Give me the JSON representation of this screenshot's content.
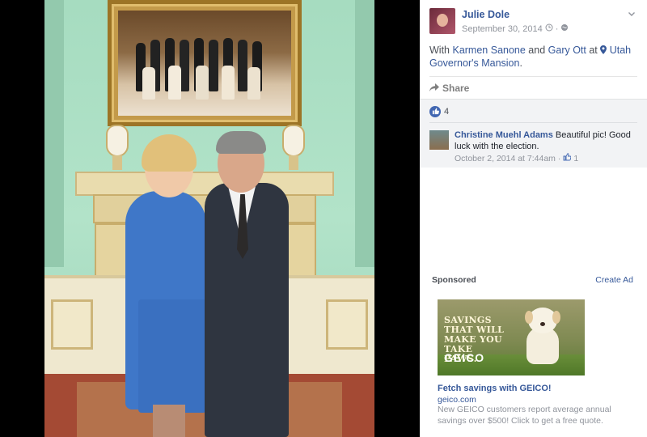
{
  "post": {
    "author": "Julie Dole",
    "date": "September 30, 2014",
    "privacy_icon": "globe-icon",
    "clock_icon": "clock-icon",
    "with_prefix": "With ",
    "tag1": "Karmen Sanone",
    "and_word": " and ",
    "tag2": "Gary Ott",
    "at_word": " at ",
    "location": "Utah Governor's Mansion",
    "period": "."
  },
  "actions": {
    "share_label": "Share"
  },
  "reactions": {
    "like_count": "4"
  },
  "comment": {
    "author": "Christine Muehl Adams",
    "text": " Beautiful pic! Good luck with the election.",
    "date": "October 2, 2014 at 7:44am",
    "separator": "·",
    "likes": "1"
  },
  "sidebar_ad": {
    "sponsored_label": "Sponsored",
    "create_ad_label": "Create Ad",
    "image_text": "SAVINGS THAT WILL MAKE YOU TAKE PAWS.",
    "image_logo": "GEICO",
    "title": "Fetch savings with GEICO!",
    "domain": "geico.com",
    "description": "New GEICO customers report average annual savings over $500! Click to get a free quote."
  },
  "colors": {
    "link": "#365899",
    "meta": "#90949c",
    "like_blue": "#4267b2"
  }
}
